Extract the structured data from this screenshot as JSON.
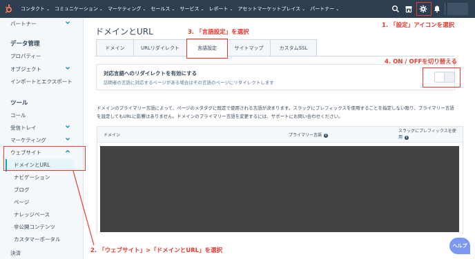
{
  "topnav": {
    "items": [
      "コンタクト",
      "コミュニケーション",
      "マーケティング",
      "セールス",
      "サービス",
      "レポート",
      "アセットマーケットプレイス",
      "パートナー"
    ]
  },
  "sidebar": {
    "partner": "パートナー",
    "data_mgmt": "データ管理",
    "property": "プロパティー",
    "object": "オブジェクト",
    "import_export": "インポートとエクスポート",
    "tools": "ツール",
    "call": "コール",
    "inbox": "受信トレイ",
    "marketing": "マーケティング",
    "website": "ウェブサイト",
    "domains_urls": "ドメインとURL",
    "navigation": "ナビゲーション",
    "blog": "ブログ",
    "pages": "ページ",
    "knowledge_base": "ナレッジベース",
    "private_content": "非公開コンテンツ",
    "customer_portal": "カスタマーポータル",
    "payments": "決済"
  },
  "main": {
    "title": "ドメインとURL",
    "tabs": [
      "ドメイン",
      "URLリダイレクト",
      "言語設定",
      "サイトマップ",
      "カスタムSSL"
    ],
    "toggle_title": "対応言語へのリダイレクトを有効にする",
    "toggle_desc": "訪問者の言語に対応するページがある場合はその言語のページにリダイレクトします",
    "toggle_state": "off",
    "description": "ドメインのプライマリー言語によって、ページのメタタグに既定で使用される言語が決まります。スラッグにプレフィックスを使用することを指定しない限り、プライマリー言語を設定してもURLに影響はありません。ドメインのプライマリー言語を変更するには、サポートにお問い合わせください。",
    "col_domain": "ドメイン",
    "col_primary": "プライマリー言語",
    "col_prefix": "スラッグにプレフィックスを使用"
  },
  "annotations": {
    "a1": "1. 「設定」アイコンを選択",
    "a2": "2. 「ウェブサイト」>「ドメインとURL」を選択",
    "a3": "3. 「言語設定」を選択",
    "a4": "4. ON / OFFを切り替える"
  },
  "help": "ヘルプ",
  "colors": {
    "nav_bg": "#2d3e50",
    "annotation": "#e8392d",
    "accent": "#00a4bd",
    "help_bg": "#7c98f4"
  }
}
